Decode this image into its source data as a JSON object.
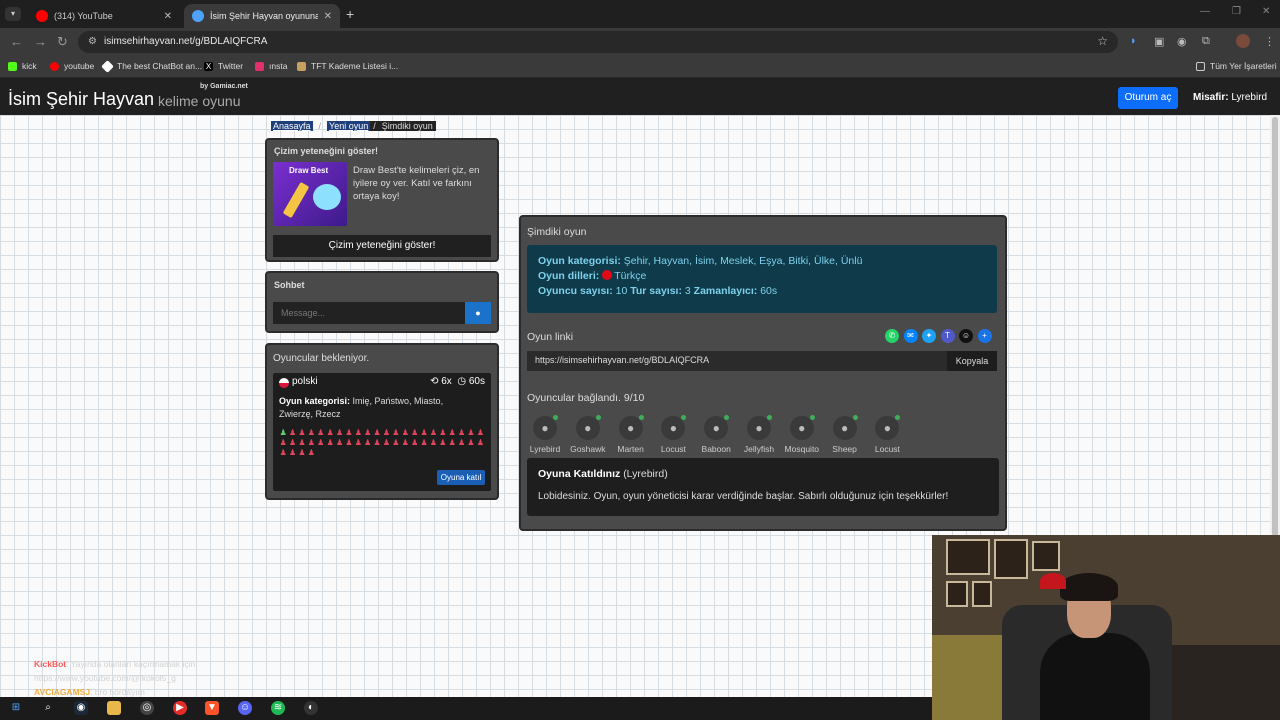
{
  "browser": {
    "tabs": [
      {
        "title": "(314) YouTube",
        "favicon_color": "#ff0000"
      },
      {
        "title": "İsim Şehir Hayvan oyununa katı",
        "favicon_color": "#4ea3ff"
      }
    ],
    "new_tab": "+",
    "url": "isimsehirhayvan.net/g/BDLAIQFCRA",
    "bookmarks": [
      {
        "label": "kick",
        "color": "#53fc18"
      },
      {
        "label": "youtube",
        "color": "#ff0000"
      },
      {
        "label": "The best ChatBot an...",
        "color": "#ffffff"
      },
      {
        "label": "Twitter",
        "color": "#000000"
      },
      {
        "label": "ınsta",
        "color": "#e1306c"
      },
      {
        "label": "TFT Kademe Listesi i...",
        "color": "#c8a060"
      }
    ],
    "all_bookmarks": "Tüm Yer İşaretleri"
  },
  "site": {
    "logo_main": "İsim Şehir Hayvan",
    "logo_sub": "kelime oyunu",
    "logo_by": "by Gamiac.net",
    "login": "Oturum aç",
    "guest_label": "Misafir:",
    "guest_name": "Lyrebird"
  },
  "breadcrumb": {
    "home": "Anasayfa",
    "sep": "/",
    "new_game": "Yeni oyun",
    "current": "Şimdiki oyun"
  },
  "draw_promo": {
    "title": "Çizim yeteneğini göster!",
    "image_text": "Draw Best",
    "text": "Draw Best'te kelimeleri çiz, en iyilere oy ver. Katıl ve farkını ortaya koy!",
    "button": "Çizim yeteneğini göster!"
  },
  "chat": {
    "title": "Sohbet",
    "placeholder": "Message..."
  },
  "waiting": {
    "title": "Oyuncular bekleniyor.",
    "language": "polski",
    "rounds": "6x",
    "timer": "60s",
    "category_label": "Oyun kategorisi:",
    "category_value": "Imię, Państwo, Miasto, Zwierzę, Rzecz",
    "seats_filled": 1,
    "seats_total": 48,
    "join": "Oyuna katıl"
  },
  "current_game": {
    "title": "Şimdiki oyun",
    "category_label": "Oyun kategorisi:",
    "category_value": "Şehir, Hayvan, İsim, Meslek, Eşya, Bitki, Ülke, Ünlü",
    "lang_label": "Oyun dilleri:",
    "lang_value": "Türkçe",
    "players_label": "Oyuncu sayısı:",
    "players_value": "10",
    "rounds_label": "Tur sayısı:",
    "rounds_value": "3",
    "timer_label": "Zamanlayıcı:",
    "timer_value": "60s",
    "link_title": "Oyun linki",
    "link_value": "https://isimsehirhayvan.net/g/BDLAIQFCRA",
    "copy": "Kopyala",
    "share_icons": [
      {
        "name": "whatsapp-icon",
        "color": "#25d366",
        "glyph": "✆"
      },
      {
        "name": "messenger-icon",
        "color": "#0084ff",
        "glyph": "✉"
      },
      {
        "name": "twitter-icon",
        "color": "#1da1f2",
        "glyph": "✦"
      },
      {
        "name": "teams-icon",
        "color": "#5059c9",
        "glyph": "T"
      },
      {
        "name": "snapchat-icon",
        "color": "#111111",
        "glyph": "☺"
      },
      {
        "name": "more-share-icon",
        "color": "#1a73e8",
        "glyph": "+"
      }
    ],
    "connected_title": "Oyuncular bağlandı. 9/10",
    "players": [
      "Lyrebird",
      "Goshawk",
      "Marten",
      "Locust",
      "Baboon",
      "Jellyfish",
      "Mosquito",
      "Sheep",
      "Locust"
    ],
    "joined_title": "Oyuna Katıldınız",
    "joined_name": "(Lyrebird)",
    "joined_text": "Lobidesiniz. Oyun, oyun yöneticisi karar verdiğinde başlar. Sabırlı olduğunuz için teşekkürler!"
  },
  "stream_chat": [
    {
      "user": "KickBot",
      "text": ": Yayında olanları kaçırmamak için"
    },
    {
      "user": "",
      "text": "https://www.youtube.com/@fkokol5_g"
    },
    {
      "user": "AVCIAGAMSJ",
      "text": ": bro hordayım"
    }
  ]
}
